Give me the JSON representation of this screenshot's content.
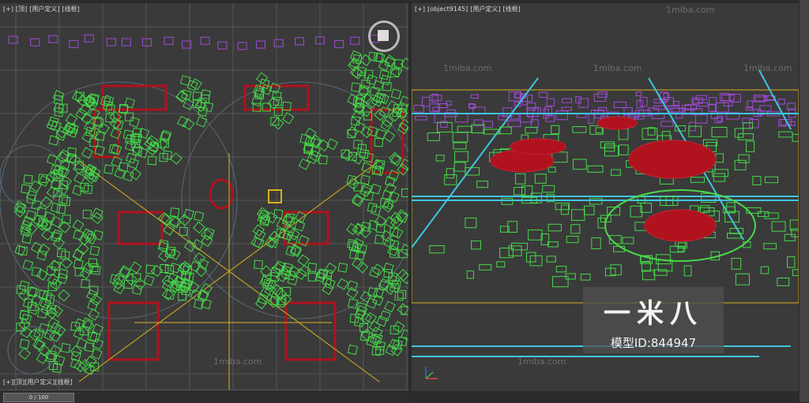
{
  "left_viewport": {
    "label": [
      "[+]",
      "[顶]",
      "[用户定义]",
      "[线框]"
    ],
    "bottom_label": [
      "[+]",
      "[顶]",
      "[用户定义]",
      "[线框]"
    ],
    "watermark": "1miba.com"
  },
  "right_viewport": {
    "label": [
      "[+]",
      "[object9145]",
      "[用户定义]",
      "[线框]"
    ],
    "watermarks": [
      "1miba.com",
      "1miba.com",
      "1miba.com",
      "1miba.com",
      "1miba.com"
    ]
  },
  "brand": {
    "title": "一米八",
    "model_id": "模型ID:844947"
  },
  "timeline": {
    "frame": "0 / 100"
  },
  "colors": {
    "wire_green": "#46d84a",
    "wire_red": "#b0121e",
    "wire_cyan": "#3fc6e0",
    "wire_magenta": "#a04bd8",
    "wire_yellow": "#d8b020",
    "ground": "#3a3a3a"
  },
  "icons": [
    "viewcube-icon",
    "axis-gizmo-icon"
  ]
}
